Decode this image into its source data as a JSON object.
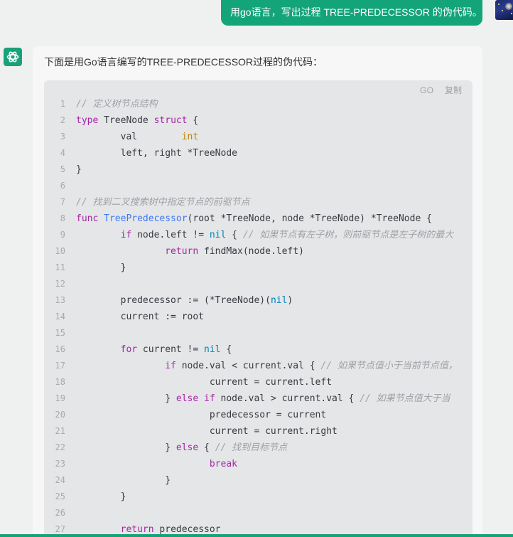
{
  "user": {
    "message": "用go语言，写出过程 TREE-PREDECESSOR 的伪代码。"
  },
  "bot": {
    "intro": "下面是用Go语言编写的TREE-PREDECESSOR过程的伪代码：",
    "code_block": {
      "language": "GO",
      "copy_label": "复制",
      "lines": [
        {
          "n": "1",
          "tokens": [
            {
              "t": "// 定义树节点结构",
              "c": "cm"
            }
          ]
        },
        {
          "n": "2",
          "tokens": [
            {
              "t": "type",
              "c": "kw"
            },
            {
              "t": " TreeNode ",
              "c": "plain"
            },
            {
              "t": "struct",
              "c": "kw"
            },
            {
              "t": " {",
              "c": "plain"
            }
          ]
        },
        {
          "n": "3",
          "tokens": [
            {
              "t": "        val        ",
              "c": "plain"
            },
            {
              "t": "int",
              "c": "ty"
            }
          ]
        },
        {
          "n": "4",
          "tokens": [
            {
              "t": "        left, right *TreeNode",
              "c": "plain"
            }
          ]
        },
        {
          "n": "5",
          "tokens": [
            {
              "t": "}",
              "c": "plain"
            }
          ]
        },
        {
          "n": "6",
          "tokens": []
        },
        {
          "n": "7",
          "tokens": [
            {
              "t": "// 找到二叉搜索树中指定节点的前驱节点",
              "c": "cm"
            }
          ]
        },
        {
          "n": "8",
          "tokens": [
            {
              "t": "func",
              "c": "kw"
            },
            {
              "t": " ",
              "c": "plain"
            },
            {
              "t": "TreePredecessor",
              "c": "fn"
            },
            {
              "t": "(root *TreeNode, node *TreeNode) *TreeNode {",
              "c": "plain"
            }
          ]
        },
        {
          "n": "9",
          "tokens": [
            {
              "t": "        ",
              "c": "plain"
            },
            {
              "t": "if",
              "c": "kw"
            },
            {
              "t": " node.left != ",
              "c": "plain"
            },
            {
              "t": "nil",
              "c": "lit"
            },
            {
              "t": " { ",
              "c": "plain"
            },
            {
              "t": "// 如果节点有左子树，则前驱节点是左子树的最大",
              "c": "cm"
            }
          ]
        },
        {
          "n": "10",
          "tokens": [
            {
              "t": "                ",
              "c": "plain"
            },
            {
              "t": "return",
              "c": "kw"
            },
            {
              "t": " findMax(node.left)",
              "c": "plain"
            }
          ]
        },
        {
          "n": "11",
          "tokens": [
            {
              "t": "        }",
              "c": "plain"
            }
          ]
        },
        {
          "n": "12",
          "tokens": []
        },
        {
          "n": "13",
          "tokens": [
            {
              "t": "        predecessor := (*TreeNode)(",
              "c": "plain"
            },
            {
              "t": "nil",
              "c": "lit"
            },
            {
              "t": ")",
              "c": "plain"
            }
          ]
        },
        {
          "n": "14",
          "tokens": [
            {
              "t": "        current := root",
              "c": "plain"
            }
          ]
        },
        {
          "n": "15",
          "tokens": []
        },
        {
          "n": "16",
          "tokens": [
            {
              "t": "        ",
              "c": "plain"
            },
            {
              "t": "for",
              "c": "kw"
            },
            {
              "t": " current != ",
              "c": "plain"
            },
            {
              "t": "nil",
              "c": "lit"
            },
            {
              "t": " {",
              "c": "plain"
            }
          ]
        },
        {
          "n": "17",
          "tokens": [
            {
              "t": "                ",
              "c": "plain"
            },
            {
              "t": "if",
              "c": "kw"
            },
            {
              "t": " node.val < current.val { ",
              "c": "plain"
            },
            {
              "t": "// 如果节点值小于当前节点值，",
              "c": "cm"
            }
          ]
        },
        {
          "n": "18",
          "tokens": [
            {
              "t": "                        current = current.left",
              "c": "plain"
            }
          ]
        },
        {
          "n": "19",
          "tokens": [
            {
              "t": "                } ",
              "c": "plain"
            },
            {
              "t": "else",
              "c": "kw"
            },
            {
              "t": " ",
              "c": "plain"
            },
            {
              "t": "if",
              "c": "kw"
            },
            {
              "t": " node.val > current.val { ",
              "c": "plain"
            },
            {
              "t": "// 如果节点值大于当",
              "c": "cm"
            }
          ]
        },
        {
          "n": "20",
          "tokens": [
            {
              "t": "                        predecessor = current",
              "c": "plain"
            }
          ]
        },
        {
          "n": "21",
          "tokens": [
            {
              "t": "                        current = current.right",
              "c": "plain"
            }
          ]
        },
        {
          "n": "22",
          "tokens": [
            {
              "t": "                } ",
              "c": "plain"
            },
            {
              "t": "else",
              "c": "kw"
            },
            {
              "t": " { ",
              "c": "plain"
            },
            {
              "t": "// 找到目标节点",
              "c": "cm"
            }
          ]
        },
        {
          "n": "23",
          "tokens": [
            {
              "t": "                        ",
              "c": "plain"
            },
            {
              "t": "break",
              "c": "kw"
            }
          ]
        },
        {
          "n": "24",
          "tokens": [
            {
              "t": "                }",
              "c": "plain"
            }
          ]
        },
        {
          "n": "25",
          "tokens": [
            {
              "t": "        }",
              "c": "plain"
            }
          ]
        },
        {
          "n": "26",
          "tokens": []
        },
        {
          "n": "27",
          "tokens": [
            {
              "t": "        ",
              "c": "plain"
            },
            {
              "t": "return",
              "c": "kw"
            },
            {
              "t": " predecessor",
              "c": "plain"
            }
          ]
        }
      ]
    }
  },
  "colors": {
    "accent": "#14a47a",
    "keyword": "#a626a4",
    "function": "#4078f2",
    "type": "#c18401",
    "comment": "#a0a1a7",
    "literal": "#0184bc"
  },
  "icons": {
    "bot_avatar": "chatgpt-logo-icon",
    "user_avatar": "starry-night-avatar"
  }
}
